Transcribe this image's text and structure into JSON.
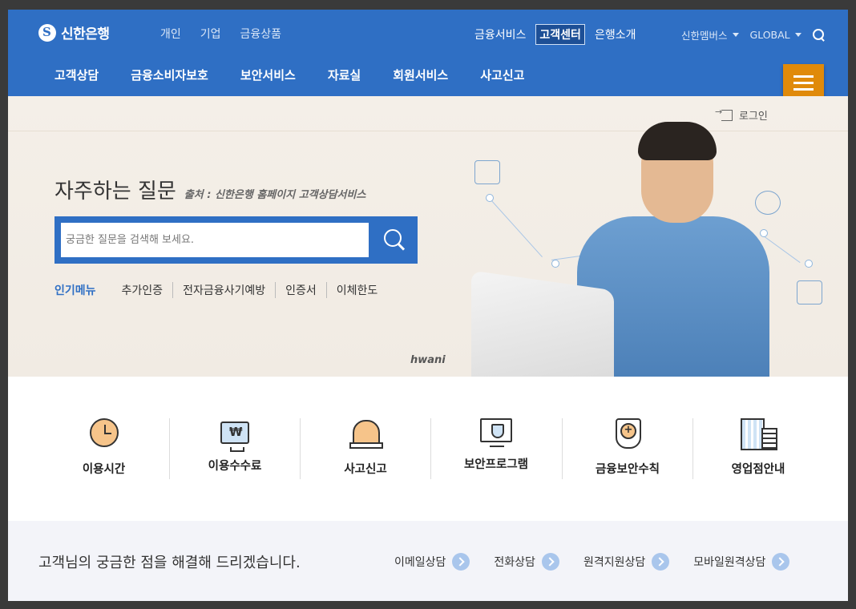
{
  "header": {
    "logo_text": "신한은행",
    "categories": [
      "개인",
      "기업",
      "금융상품"
    ],
    "util_nav": [
      "금융서비스",
      "고객센터",
      "은행소개"
    ],
    "active_util": "고객센터",
    "members_label": "신한멤버스",
    "global_label": "GLOBAL"
  },
  "main_menu": [
    "고객상담",
    "금융소비자보호",
    "보안서비스",
    "자료실",
    "회원서비스",
    "사고신고"
  ],
  "login_label": "로그인",
  "hero": {
    "title": "자주하는 질문",
    "source": "출처 : 신한은행 홈페이지 고객상담서비스",
    "search_placeholder": "궁금한 질문을 검색해 보세요.",
    "popular_head": "인기메뉴",
    "popular_items": [
      "추가인증",
      "전자금융사기예방",
      "인증서",
      "이체한도"
    ],
    "watermark": "hwani"
  },
  "quick_links": [
    {
      "label": "이용시간",
      "icon": "clock-icon"
    },
    {
      "label": "이용수수료",
      "icon": "fee-monitor-icon"
    },
    {
      "label": "사고신고",
      "icon": "alarm-bell-icon"
    },
    {
      "label": "보안프로그램",
      "icon": "security-monitor-icon"
    },
    {
      "label": "금융보안수칙",
      "icon": "shield-icon"
    },
    {
      "label": "영업점안내",
      "icon": "building-icon"
    }
  ],
  "bottom": {
    "message": "고객님의 궁금한 점을 해결해 드리겠습니다.",
    "links": [
      "이메일상담",
      "전화상담",
      "원격지원상담",
      "모바일원격상담"
    ]
  },
  "colors": {
    "brand_blue": "#2f6fc4",
    "menu_orange": "#e08a0a",
    "hero_bg": "#f4efe8",
    "bottom_bg": "#f3f4f9"
  }
}
